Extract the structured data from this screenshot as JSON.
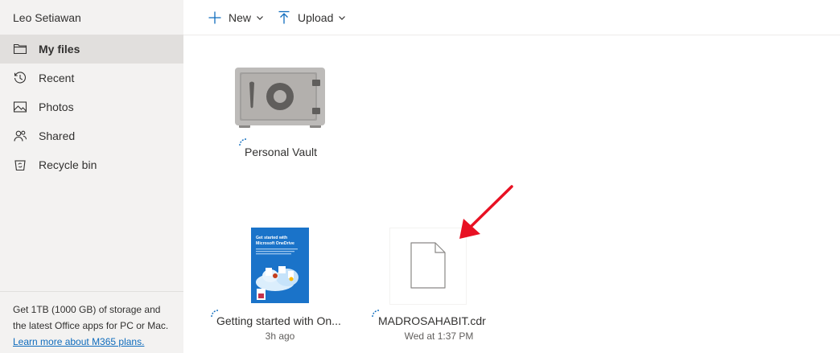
{
  "sidebar": {
    "user_name": "Leo Setiawan",
    "items": [
      {
        "label": "My files",
        "icon": "folder-icon",
        "active": true
      },
      {
        "label": "Recent",
        "icon": "history-icon",
        "active": false
      },
      {
        "label": "Photos",
        "icon": "image-icon",
        "active": false
      },
      {
        "label": "Shared",
        "icon": "people-icon",
        "active": false
      },
      {
        "label": "Recycle bin",
        "icon": "recycle-bin-icon",
        "active": false
      }
    ],
    "promo": {
      "text": "Get 1TB (1000 GB) of storage and the latest Office apps for PC or Mac.",
      "link": "Learn more about M365 plans."
    }
  },
  "toolbar": {
    "new_label": "New",
    "upload_label": "Upload"
  },
  "files": [
    {
      "name": "Personal Vault",
      "meta": "",
      "type": "vault"
    },
    {
      "name": "Getting started with On...",
      "meta": "3h ago",
      "type": "document-preview"
    },
    {
      "name": "MADROSAHABIT.cdr",
      "meta": "Wed at 1:37 PM",
      "type": "generic-file"
    }
  ],
  "thumbnail_text": {
    "title_line1": "Get started with",
    "title_line2": "Microsoft OneDrive"
  },
  "colors": {
    "accent": "#0f6cbd",
    "sidebar_bg": "#f3f2f1",
    "active_item_bg": "#e1dfdd",
    "arrow": "#e81123",
    "thumbnail_blue": "#1a73c9"
  }
}
